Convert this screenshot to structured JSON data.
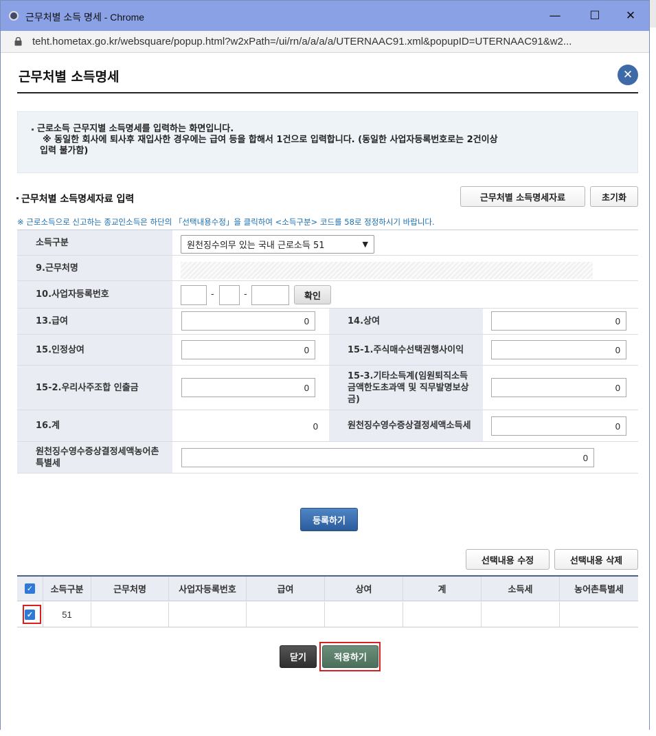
{
  "window": {
    "title": "근무처별 소득 명세 - Chrome",
    "url": "teht.hometax.go.kr/websquare/popup.html?w2xPath=/ui/rn/a/a/a/a/UTERNAAC91.xml&popupID=UTERNAAC91&w2..."
  },
  "popup": {
    "title": "근무처별 소득명세",
    "close_symbol": "✕"
  },
  "notice": {
    "line1": "근로소득 근무지별 소득명세를 입력하는 화면입니다.",
    "line2": "※ 동일한 회사에 퇴사후 재입사한 경우에는 급여 등을 합해서 1건으로 입력합니다. (동일한 사업자등록번호로는 2건이상",
    "line3": "입력 불가함)"
  },
  "section": {
    "title": "근무처별 소득명세자료 입력",
    "btn_data": "근무처별 소득명세자료",
    "btn_reset": "초기화",
    "info": "※ 근로소득으로 신고하는 종교인소득은 하단의 「선택내용수정」을 클릭하여 <소득구분> 코드를 58로 정정하시기 바랍니다."
  },
  "form": {
    "income_type_label": "소득구분",
    "income_type_value": "원천징수의무 있는 국내 근로소득 51",
    "workplace_label": "9.근무처명",
    "bizno_label": "10.사업자등록번호",
    "bizno_dash": "-",
    "confirm_btn": "확인",
    "salary_label": "13.급여",
    "salary_value": "0",
    "bonus_label": "14.상여",
    "bonus_value": "0",
    "recognized_bonus_label": "15.인정상여",
    "recognized_bonus_value": "0",
    "stock_option_label": "15-1.주식매수선택권행사이익",
    "stock_option_value": "0",
    "esop_label": "15-2.우리사주조합 인출금",
    "esop_value": "0",
    "other_income_label": "15-3.기타소득계(임원퇴직소득금액한도초과액 및 직무발명보상금)",
    "other_income_value": "0",
    "total_label": "16.계",
    "total_value": "0",
    "withheld_income_tax_label": "원천징수영수증상결정세액소득세",
    "withheld_income_tax_value": "0",
    "withheld_rural_tax_label": "원천징수영수증상결정세액농어촌특별세",
    "withheld_rural_tax_value": "0"
  },
  "register_btn": "등록하기",
  "list": {
    "btn_edit": "선택내용 수정",
    "btn_delete": "선택내용 삭제",
    "headers": [
      "소득구분",
      "근무처명",
      "사업자등록번호",
      "급여",
      "상여",
      "계",
      "소득세",
      "농어촌특별세"
    ],
    "rows": [
      {
        "income_type": "51",
        "workplace": "",
        "bizno": "",
        "salary": "",
        "bonus": "",
        "total": "",
        "income_tax": "",
        "rural_tax": ""
      }
    ]
  },
  "footer": {
    "close_btn": "닫기",
    "apply_btn": "적용하기"
  },
  "colors": {
    "titlebar": "#8aa1e6",
    "accent_blue": "#3e6aa8",
    "apply_green": "#5a7d69",
    "highlight_red": "#d81e1e"
  }
}
